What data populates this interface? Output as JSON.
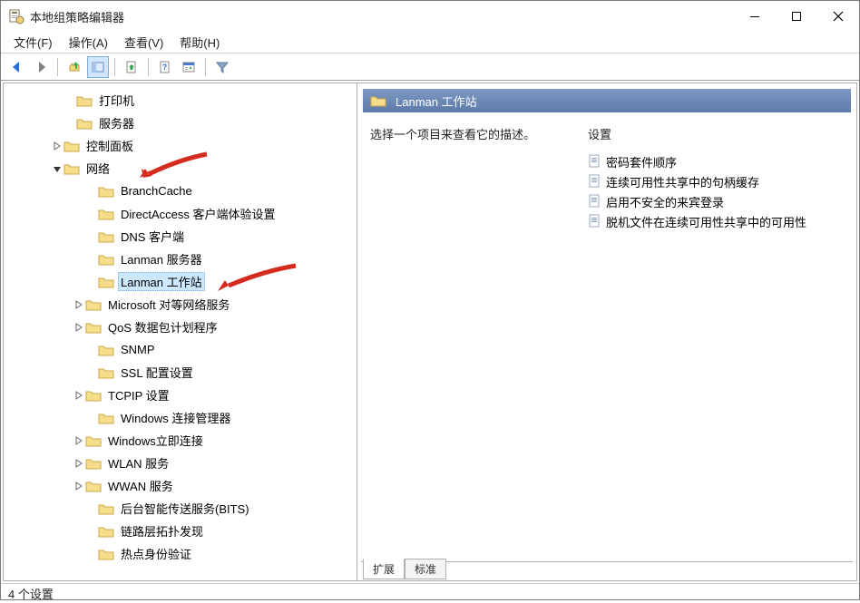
{
  "window": {
    "title": "本地组策略编辑器"
  },
  "menu": {
    "file": "文件(F)",
    "action": "操作(A)",
    "view": "查看(V)",
    "help": "帮助(H)"
  },
  "tree": {
    "printers": "打印机",
    "servers": "服务器",
    "control_panel": "控制面板",
    "network": "网络",
    "network_children": {
      "branchcache": "BranchCache",
      "directaccess": "DirectAccess 客户端体验设置",
      "dns_client": "DNS 客户端",
      "lanman_server": "Lanman 服务器",
      "lanman_workstation": "Lanman 工作站",
      "ms_p2p": "Microsoft 对等网络服务",
      "qos": "QoS 数据包计划程序",
      "snmp": "SNMP",
      "ssl": "SSL 配置设置",
      "tcpip": "TCPIP 设置",
      "wcm": "Windows 连接管理器",
      "wconn": "Windows立即连接",
      "wlan": "WLAN 服务",
      "wwan": "WWAN 服务",
      "bits": "后台智能传送服务(BITS)",
      "lltd": "链路层拓扑发现",
      "hotspot": "热点身份验证"
    }
  },
  "details": {
    "header": "Lanman 工作站",
    "description": "选择一个项目来查看它的描述。",
    "settings_label": "设置",
    "items": {
      "cipher_suite": "密码套件顺序",
      "handle_cache": "连续可用性共享中的句柄缓存",
      "insecure_guest": "启用不安全的来宾登录",
      "offline_files": "脱机文件在连续可用性共享中的可用性"
    }
  },
  "tabs": {
    "extended": "扩展",
    "standard": "标准"
  },
  "statusbar": {
    "text": "4 个设置"
  }
}
